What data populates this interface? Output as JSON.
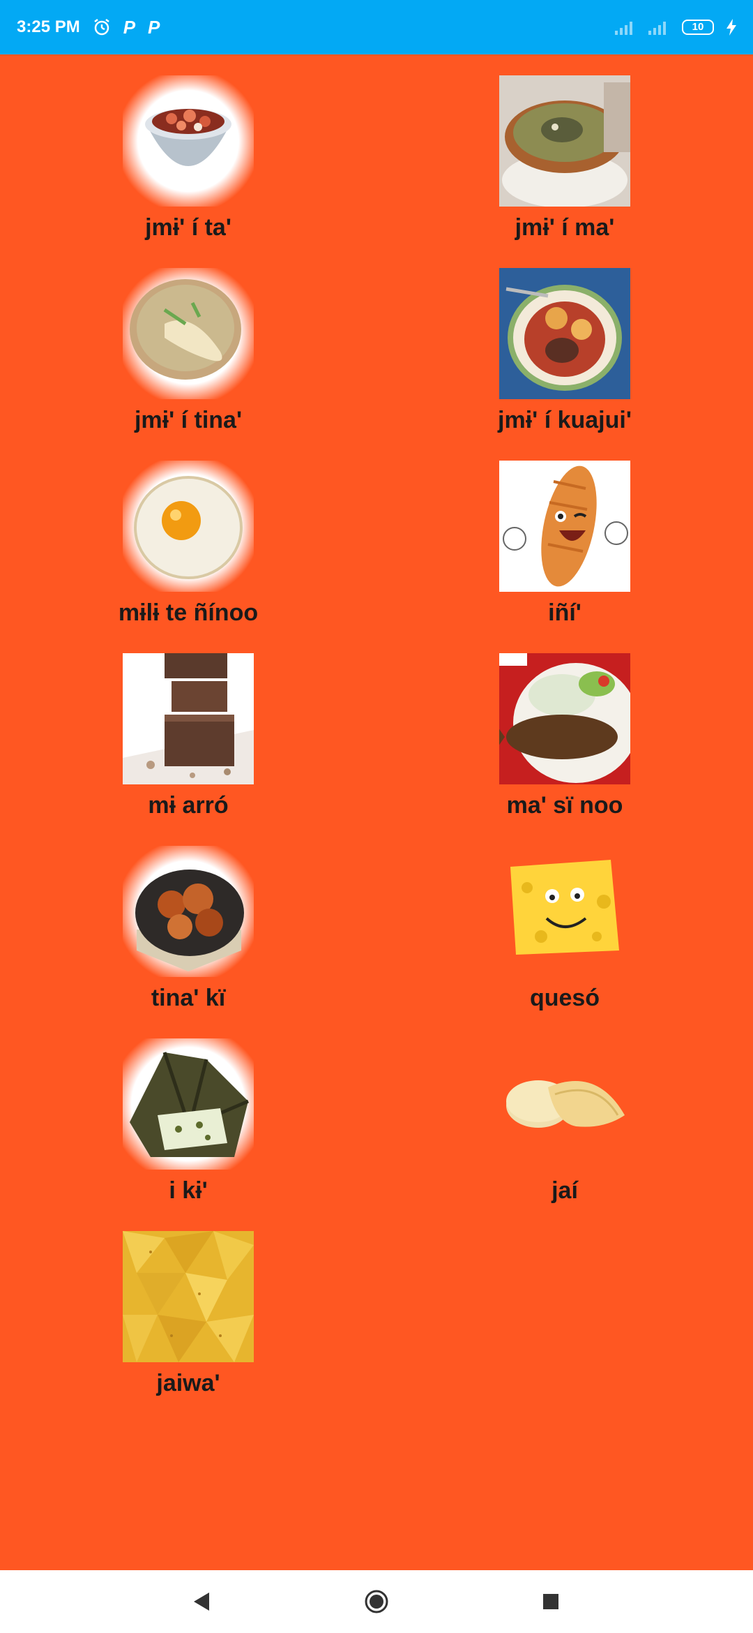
{
  "status_bar": {
    "time": "3:25 PM",
    "notif_p1": "P",
    "notif_p2": "P",
    "battery": "10"
  },
  "foods": [
    {
      "label": "jmɨ' í ta'",
      "icon": "shrimp-soup-image"
    },
    {
      "label": "jmɨ' í ma'",
      "icon": "fish-soup-image"
    },
    {
      "label": "jmɨ' í tina'",
      "icon": "chicken-soup-image"
    },
    {
      "label": "jmɨ' í kuajui'",
      "icon": "beef-soup-image"
    },
    {
      "label": "mɨlɨ te ñínoo",
      "icon": "fried-egg-image"
    },
    {
      "label": "iñí'",
      "icon": "bread-cartoon-image"
    },
    {
      "label": "mɨ arró",
      "icon": "chocolate-image"
    },
    {
      "label": "ma' sï noo",
      "icon": "fried-fish-image"
    },
    {
      "label": "tina' kï",
      "icon": "roast-chicken-image"
    },
    {
      "label": "quesó",
      "icon": "cheese-cartoon-image"
    },
    {
      "label": "i kɨ'",
      "icon": "tamal-image"
    },
    {
      "label": "jaí",
      "icon": "tortillas-image"
    },
    {
      "label": "jaiwa'",
      "icon": "tostadas-image"
    }
  ],
  "colors": {
    "background": "#ff5722",
    "status_bar": "#03a9f4"
  }
}
